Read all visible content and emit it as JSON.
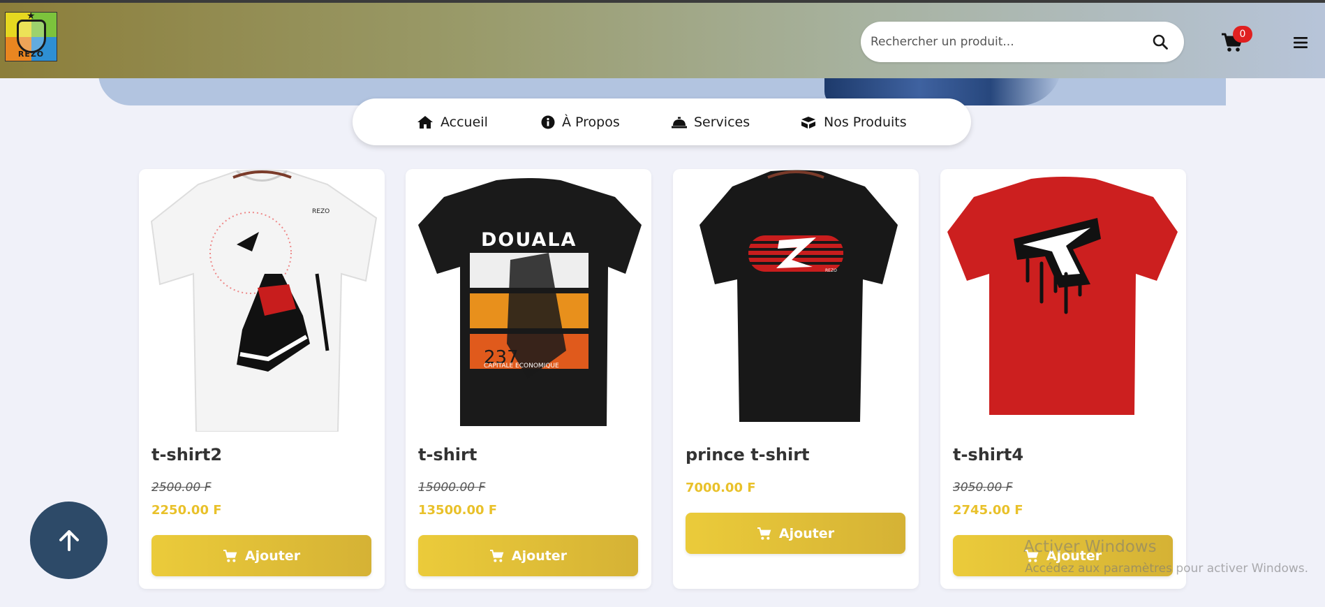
{
  "header": {
    "logo_text": "REZO",
    "search_placeholder": "Rechercher un produit...",
    "cart_count": "0"
  },
  "nav": {
    "items": [
      {
        "label": "Accueil",
        "icon": "home-icon"
      },
      {
        "label": "À Propos",
        "icon": "info-icon"
      },
      {
        "label": "Services",
        "icon": "bell-icon"
      },
      {
        "label": "Nos Produits",
        "icon": "box-icon"
      }
    ]
  },
  "products": [
    {
      "name": "t-shirt2",
      "old_price": "2500.00 F",
      "price": "2250.00 F",
      "button": "Ajouter",
      "image": "white t-shirt with sneaker print"
    },
    {
      "name": "t-shirt",
      "old_price": "15000.00 F",
      "price": "13500.00 F",
      "button": "Ajouter",
      "image": "black t-shirt Douala 237"
    },
    {
      "name": "prince t-shirt",
      "old_price": "",
      "price": "7000.00 F",
      "button": "Ajouter",
      "image": "black t-shirt striped R logo"
    },
    {
      "name": "t-shirt4",
      "old_price": "3050.00 F",
      "price": "2745.00 F",
      "button": "Ajouter",
      "image": "red t-shirt dripping R logo"
    }
  ],
  "print_text": {
    "douala": "DOUALA",
    "code": "237",
    "tagline": "CAPITALE ECONOMIQUE"
  },
  "watermark": {
    "line1": "Activer Windows",
    "line2": "Accédez aux paramètres pour activer Windows."
  },
  "colors": {
    "accent": "#e9c12a",
    "badge": "#e02020",
    "totop": "#2d4a68"
  }
}
